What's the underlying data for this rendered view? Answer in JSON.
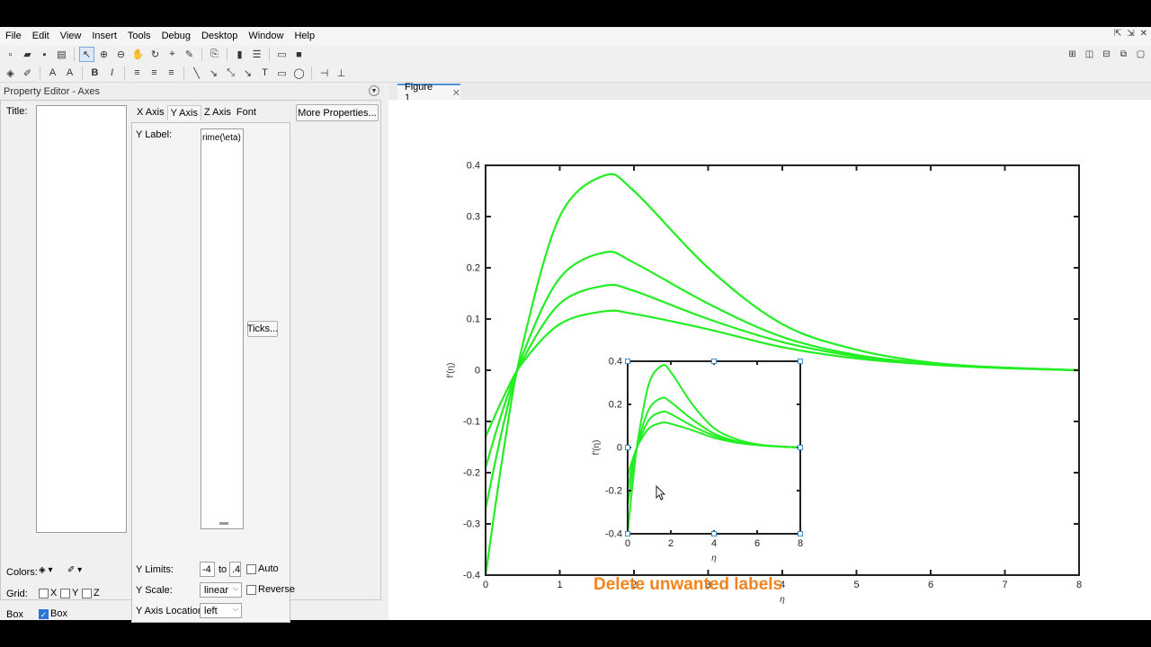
{
  "menu": [
    "File",
    "Edit",
    "View",
    "Insert",
    "Tools",
    "Debug",
    "Desktop",
    "Window",
    "Help"
  ],
  "window_controls": {
    "undock": "⇱",
    "pin": "⇲",
    "close": "✕"
  },
  "toolbar1_icons": [
    "new-figure-icon",
    "open-icon",
    "save-icon",
    "print-icon",
    "select-pointer-icon",
    "zoom-in-icon",
    "zoom-out-icon",
    "pan-icon",
    "rotate-icon",
    "data-cursor-icon",
    "brush-icon",
    "link-icon",
    "colorbar-icon",
    "legend-icon",
    "hide-tools-icon",
    "show-tools-icon"
  ],
  "toolbar2_icons": [
    "fill-color-icon",
    "line-color-icon",
    "font-color-icon",
    "font-icon",
    "bold-icon",
    "italic-icon",
    "align-left-icon",
    "align-center-icon",
    "align-right-icon",
    "line-icon",
    "arrow-icon",
    "double-arrow-icon",
    "text-arrow-icon",
    "textbox-icon",
    "rectangle-icon",
    "ellipse-icon",
    "pin-icon",
    "align-distribute-icon"
  ],
  "property_editor": {
    "header": "Property Editor - Axes",
    "title_label": "Title:",
    "tabs": [
      "X Axis",
      "Y Axis",
      "Z Axis",
      "Font"
    ],
    "active_tab": "Y Axis",
    "more_properties": "More Properties...",
    "ylabel_label": "Y Label:",
    "ylabel_value": "rime(\\eta)",
    "ticks_button": "Ticks...",
    "ylimits_label": "Y Limits:",
    "ylim_min": "-4",
    "ylim_to": "to",
    "ylim_max": ".4",
    "auto_label": "Auto",
    "yscale_label": "Y Scale:",
    "yscale_value": "linear",
    "reverse_label": "Reverse",
    "yaxis_location_label": "Y Axis Location:",
    "yaxis_location_value": "left",
    "colors_label": "Colors:",
    "grid_label": "Grid:",
    "grid_x": "X",
    "grid_y": "Y",
    "grid_z": "Z",
    "box_label": "Box",
    "box_check_label": "Box",
    "box_checked": true
  },
  "figure_tab": {
    "label": "Figure 1",
    "close": "✕"
  },
  "caption": "Delete unwanted labels",
  "chart_data": [
    {
      "type": "line",
      "xlabel": "η",
      "ylabel": "f′(η)",
      "xlim": [
        0,
        8
      ],
      "ylim": [
        -0.4,
        0.4
      ],
      "xticks": [
        0,
        1,
        2,
        3,
        4,
        5,
        6,
        7,
        8
      ],
      "yticks": [
        -0.4,
        -0.3,
        -0.2,
        -0.1,
        0,
        0.1,
        0.2,
        0.3,
        0.4
      ],
      "line_color": "#22ee22",
      "series": [
        {
          "x": [
            0,
            0.25,
            0.5,
            1,
            1.6,
            2,
            3,
            4,
            5,
            6,
            7,
            8
          ],
          "values": [
            -0.4,
            -0.15,
            0.05,
            0.3,
            0.38,
            0.35,
            0.2,
            0.09,
            0.04,
            0.015,
            0.005,
            0.0
          ]
        },
        {
          "x": [
            0,
            0.25,
            0.5,
            1,
            1.6,
            2,
            3,
            4,
            5,
            6,
            7,
            8
          ],
          "values": [
            -0.27,
            -0.1,
            0.03,
            0.18,
            0.23,
            0.21,
            0.13,
            0.065,
            0.03,
            0.013,
            0.005,
            0.0
          ]
        },
        {
          "x": [
            0,
            0.25,
            0.5,
            1,
            1.6,
            2,
            3,
            4,
            5,
            6,
            7,
            8
          ],
          "values": [
            -0.19,
            -0.07,
            0.02,
            0.13,
            0.165,
            0.155,
            0.1,
            0.055,
            0.027,
            0.012,
            0.005,
            0.0
          ]
        },
        {
          "x": [
            0,
            0.25,
            0.5,
            1,
            1.6,
            2,
            3,
            4,
            5,
            6,
            7,
            8
          ],
          "values": [
            -0.13,
            -0.05,
            0.015,
            0.09,
            0.115,
            0.11,
            0.08,
            0.045,
            0.023,
            0.011,
            0.004,
            0.0
          ]
        }
      ]
    },
    {
      "type": "line",
      "xlabel": "η",
      "ylabel": "f′(η)",
      "xlim": [
        0,
        8
      ],
      "ylim": [
        -0.4,
        0.4
      ],
      "xticks": [
        0,
        2,
        4,
        6,
        8
      ],
      "yticks": [
        -0.4,
        -0.2,
        0,
        0.2,
        0.4
      ],
      "line_color": "#22ee22"
    }
  ]
}
